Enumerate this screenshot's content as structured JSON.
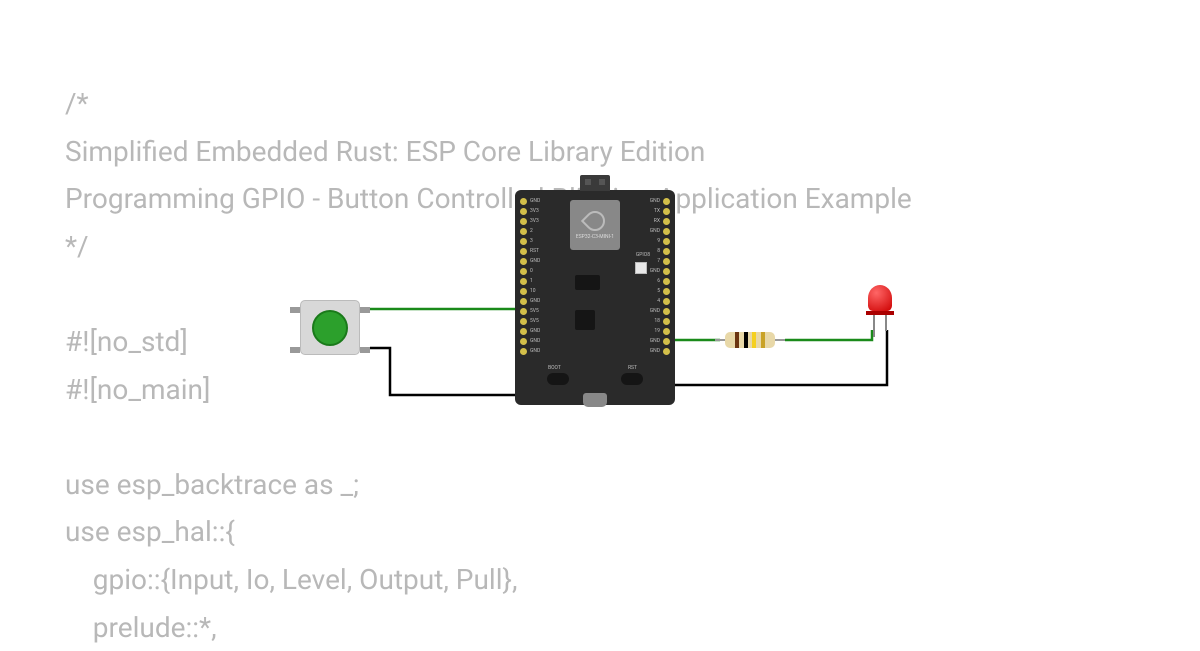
{
  "code": {
    "line1": "/*",
    "line2": "Simplified Embedded Rust: ESP Core Library Edition",
    "line3": "Programming GPIO - Button Controlled Blinking Application Example",
    "line4": "*/",
    "line5": "",
    "line6": "#![no_std]",
    "line7": "#![no_main]",
    "line8": "",
    "line9": "use esp_backtrace as _;",
    "line10": "use esp_hal::{",
    "line11": "    gpio::{Input, Io, Level, Output, Pull},",
    "line12": "    prelude::*,"
  },
  "board": {
    "chip_name": "ESP32-C3-MINI-1",
    "gpio8_label": "GPIO8",
    "boot_label": "BOOT",
    "rst_label": "RST",
    "pins_left": [
      "GND",
      "3V3",
      "3V3",
      "2",
      "3",
      "RST",
      "GND",
      "0",
      "1",
      "10",
      "GND",
      "5V5",
      "5V5",
      "GND",
      "GND",
      "GND"
    ],
    "pins_right": [
      "GND",
      "TX",
      "RX",
      "GND",
      "9",
      "8",
      "7",
      "GND",
      "6",
      "5",
      "4",
      "GND",
      "18",
      "19",
      "GND",
      "GND"
    ]
  },
  "components": {
    "button": "push-button",
    "resistor_bands": [
      "brown",
      "black",
      "yellow",
      "gold"
    ],
    "led_color": "red"
  },
  "wires": {
    "btn_to_gpio": "#1a8a1a",
    "btn_to_gnd": "#000000",
    "gpio_to_resistor": "#1a8a1a",
    "resistor_to_led": "#1a8a1a",
    "led_to_gnd": "#000000"
  }
}
